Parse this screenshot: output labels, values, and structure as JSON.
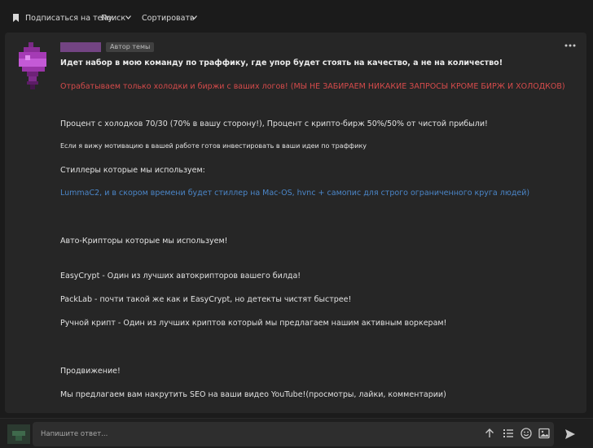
{
  "topbar": {
    "subscribe_label": "Подписаться на тему",
    "search_label": "Поиск",
    "sort_label": "Сортировать"
  },
  "post": {
    "author_badge": "Автор темы",
    "lines": [
      "Идет набор в мою команду по траффику, где упор будет стоять на качество, а не на количество!",
      "Отрабатываем только холодки и биржи с ваших логов! (МЫ НЕ ЗАБИРАЕМ НИКАКИЕ ЗАПРОСЫ КРОМЕ БИРЖ И ХОЛОДКОВ)",
      "Процент с холодков 70/30 (70% в вашу сторону!), Процент с крипто-бирж 50%/50% от чистой прибыли!",
      "Если я вижу мотивацию в вашей работе готов инвестировать в ваши идеи по траффику",
      "Стиллеры которые мы используем:",
      "LummaC2, и в скором времени будет стиллер на Mac-OS, hvnc + самопис для строго ограниченного круга людей)",
      "Авто-Крипторы которые мы используем!",
      "EasyCrypt - Один из лучших автокрипторов вашего билда!",
      "PackLab - почти такой же как и EasyCrypt, но детекты чистят быстрее!",
      "Ручной крипт - Один из лучших криптов который мы предлагаем нашим активным воркерам!",
      "Продвижение!",
      "Мы предлагаем вам накрутить SEO на ваши видео YouTube!(просмотры, лайки, комментарии)"
    ]
  },
  "reply": {
    "placeholder": "Напишите ответ..."
  },
  "colors": {
    "background": "#1b1b1b",
    "post_background": "#262626",
    "red_text": "#d64b4b",
    "blue_link": "#4b86c8",
    "username": "#8e4fa3"
  },
  "icons": [
    "bookmark-icon",
    "chevron-down-icon",
    "more-options-icon",
    "arrow-up-icon",
    "list-icon",
    "emoji-icon",
    "image-icon",
    "send-icon"
  ]
}
